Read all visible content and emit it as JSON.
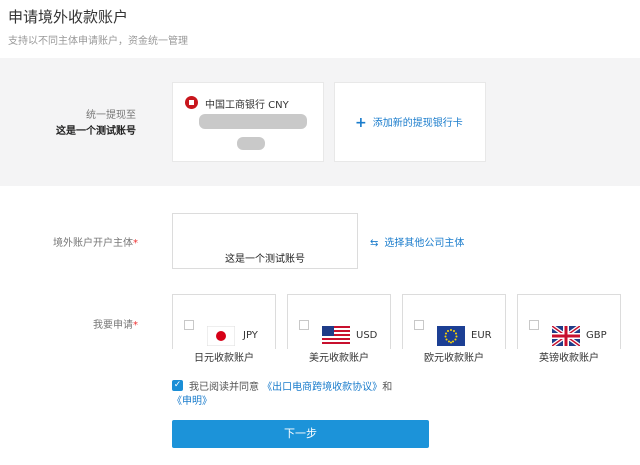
{
  "header": {
    "title": "申请境外收款账户",
    "subtitle": "支持以不同主体申请账户，资金统一管理"
  },
  "withdraw": {
    "label": "统一提现至",
    "account_name": "这是一个测试账号",
    "bank_name": "中国工商银行 CNY",
    "add_card_label": "添加新的提现银行卡",
    "add_card_icon": "plus-icon"
  },
  "entity": {
    "label": "境外账户开户主体",
    "required_mark": "*",
    "selected_name": "这是一个测试账号",
    "switch_label": "选择其他公司主体",
    "switch_icon": "swap-icon"
  },
  "apply": {
    "label": "我要申请",
    "required_mark": "*",
    "currencies": [
      {
        "code": "JPY",
        "name": "日元收款账户",
        "flag": "japan-flag-icon",
        "checked": false
      },
      {
        "code": "USD",
        "name": "美元收款账户",
        "flag": "usa-flag-icon",
        "checked": false
      },
      {
        "code": "EUR",
        "name": "欧元收款账户",
        "flag": "eu-flag-icon",
        "checked": false
      },
      {
        "code": "GBP",
        "name": "英镑收款账户",
        "flag": "uk-flag-icon",
        "checked": false
      }
    ]
  },
  "agreement": {
    "checked": true,
    "prefix": "我已阅读并同意",
    "agreement_link": "《出口电商跨境收款协议》",
    "conjunction": "和",
    "statement_link": "《申明》"
  },
  "actions": {
    "next_label": "下一步"
  },
  "colors": {
    "accent": "#1a7ccc",
    "button": "#1c93d9",
    "required": "#e33333",
    "band": "#f4f4f5"
  }
}
